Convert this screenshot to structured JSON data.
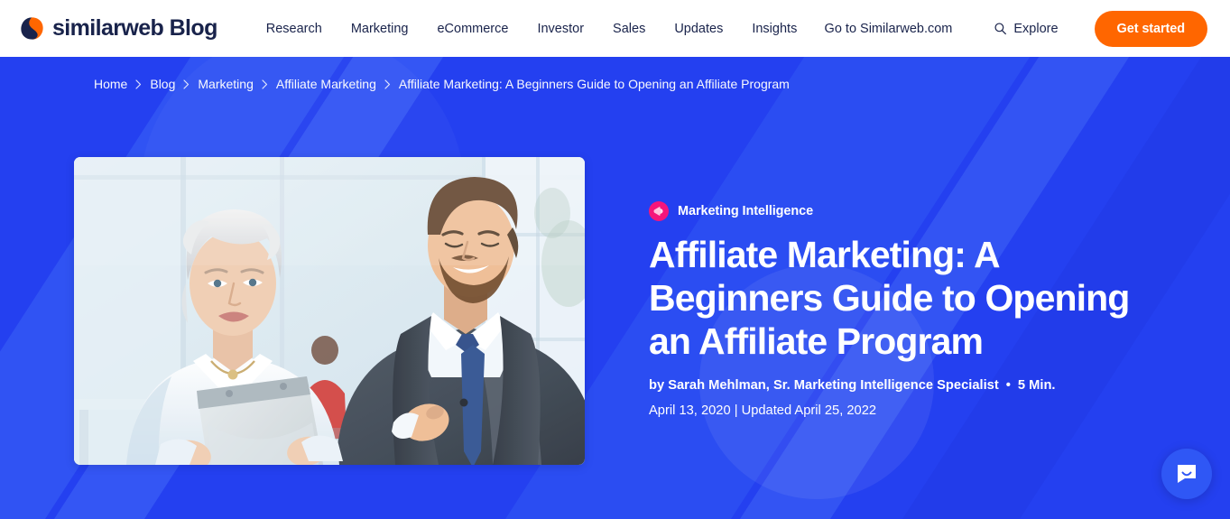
{
  "navbar": {
    "brand_name": "similarweb",
    "brand_suffix": "Blog",
    "logo_icon": "similarweb-logo-icon",
    "links": [
      {
        "label": "Research"
      },
      {
        "label": "Marketing"
      },
      {
        "label": "eCommerce"
      },
      {
        "label": "Investor"
      },
      {
        "label": "Sales"
      },
      {
        "label": "Updates"
      },
      {
        "label": "Insights"
      }
    ],
    "go_to_site_label": "Go to Similarweb.com",
    "explore_label": "Explore",
    "search_icon": "search-icon",
    "cta_label": "Get started"
  },
  "breadcrumb": {
    "items": [
      {
        "label": "Home"
      },
      {
        "label": "Blog"
      },
      {
        "label": "Marketing"
      },
      {
        "label": "Affiliate Marketing"
      },
      {
        "label": "Affiliate Marketing: A Beginners Guide to Opening an Affiliate Program"
      }
    ],
    "separator_icon": "chevron-right-icon"
  },
  "hero": {
    "featured_image_alt": "Two business professionals, an older woman holding a clipboard and a younger bearded man in a suit, talking in a bright modern office",
    "category": {
      "label": "Marketing Intelligence",
      "icon": "megaphone-icon",
      "color": "#f5157b"
    },
    "title": "Affiliate Marketing: A Beginners Guide to Opening an Affiliate Program",
    "byline_author": "by Sarah Mehlman, Sr. Marketing Intelligence Specialist",
    "byline_separator": "•",
    "read_time": "5 Min.",
    "date": "April 13, 2020 | Updated April 25, 2022"
  },
  "chat": {
    "icon": "chat-bubble-smile-icon",
    "label": "Open chat"
  },
  "colors": {
    "hero_blue": "#2440f0",
    "hero_band_light": "#3b65f7",
    "brand_navy": "#19234b",
    "cta_orange": "#ff6600",
    "category_pink": "#f5157b",
    "chat_blue": "#2f57f5"
  }
}
